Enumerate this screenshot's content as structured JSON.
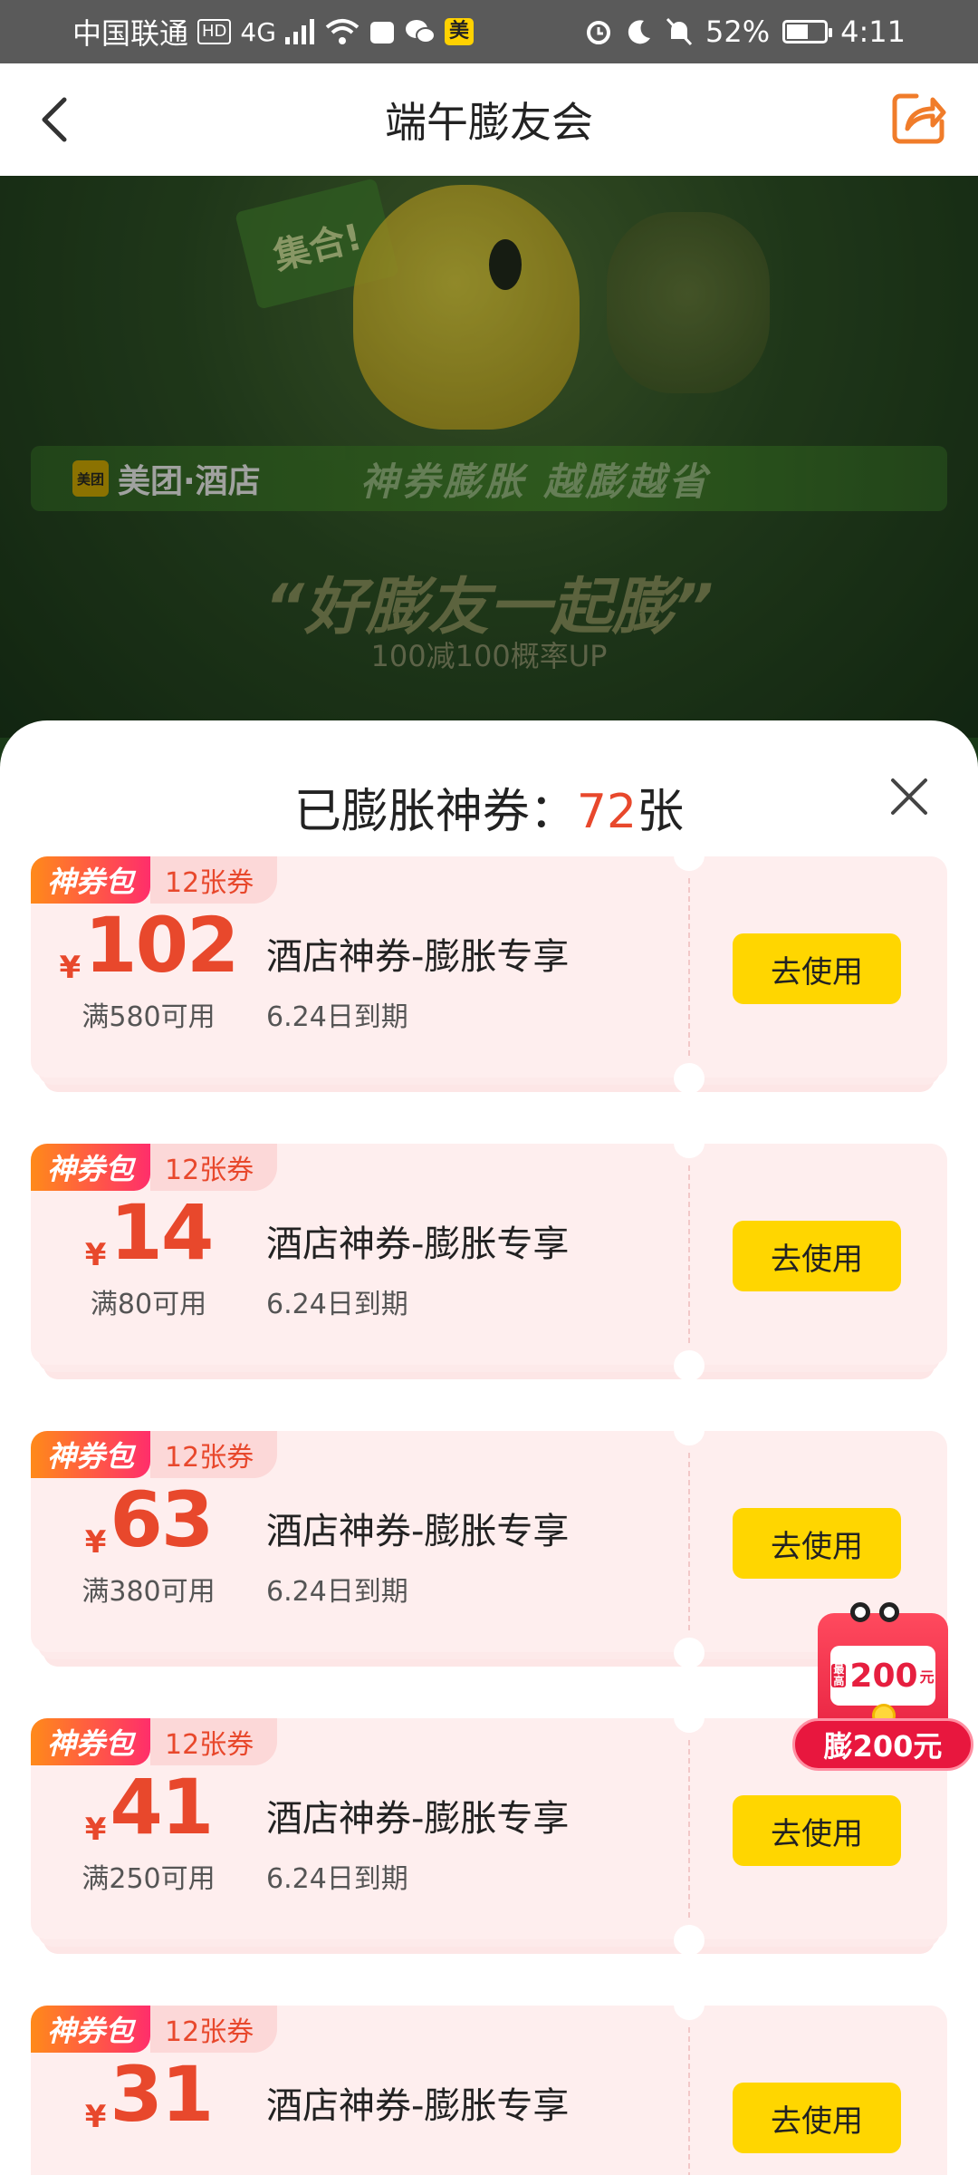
{
  "status_bar": {
    "carrier": "中国联通",
    "hd": "HD",
    "network": "4G",
    "app_badge": "美",
    "battery": "52%",
    "battery_fraction": 0.52,
    "time": "4:11"
  },
  "navbar": {
    "title": "端午膨友会",
    "back_icon": "chevron-left-icon",
    "share_icon": "share-icon"
  },
  "banner": {
    "flag_text": "集合!",
    "brand_logo": "美团",
    "brand_name": "美团·酒店",
    "slogan": "神券膨胀 越膨越省",
    "headline": "“好膨友一起膨”",
    "sub": "100减100概率UP"
  },
  "sheet": {
    "title_prefix": "已膨胀神券：",
    "count": "72",
    "title_suffix": "张",
    "close_icon": "close-icon"
  },
  "coupons": [
    {
      "tag": "神券包",
      "count": "12张券",
      "yen": "¥",
      "amount": "102",
      "condition": "满580可用",
      "name": "酒店神券-膨胀专享",
      "expire": "6.24日到期",
      "button": "去使用"
    },
    {
      "tag": "神券包",
      "count": "12张券",
      "yen": "¥",
      "amount": "14",
      "condition": "满80可用",
      "name": "酒店神券-膨胀专享",
      "expire": "6.24日到期",
      "button": "去使用"
    },
    {
      "tag": "神券包",
      "count": "12张券",
      "yen": "¥",
      "amount": "63",
      "condition": "满380可用",
      "name": "酒店神券-膨胀专享",
      "expire": "6.24日到期",
      "button": "去使用"
    },
    {
      "tag": "神券包",
      "count": "12张券",
      "yen": "¥",
      "amount": "41",
      "condition": "满250可用",
      "name": "酒店神券-膨胀专享",
      "expire": "6.24日到期",
      "button": "去使用"
    },
    {
      "tag": "神券包",
      "count": "12张券",
      "yen": "¥",
      "amount": "31",
      "condition": "",
      "name": "酒店神券-膨胀专享",
      "expire": "",
      "button": "去使用"
    }
  ],
  "float_pack": {
    "badge": "最高",
    "amount": "200",
    "unit": "元",
    "label": "膨200元"
  },
  "colors": {
    "accent_red": "#e8482c",
    "button_yellow": "#ffd600",
    "coupon_bg": "#feeeee"
  }
}
